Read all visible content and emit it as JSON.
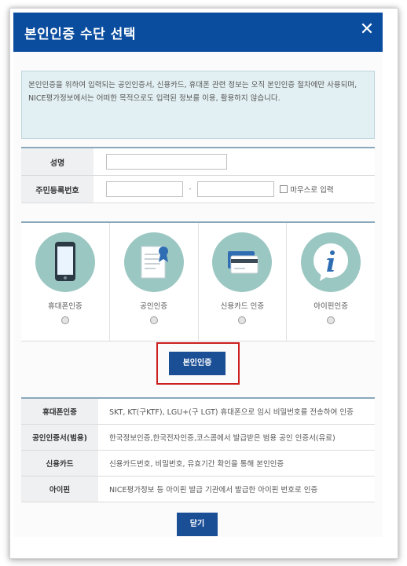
{
  "dialog": {
    "title": "본인인증 수단 선택",
    "close_icon": "close-icon",
    "notice": "본인인증을 위하여 입력되는 공인인증서, 신용카드, 휴대폰 관련 정보는 오직 본인인증 절차에만 사용되며, NICE평가정보에서는 어떠한 목적으로도 입력된 정보를 이용, 활용하지 않습니다."
  },
  "form": {
    "name_label": "성명",
    "name_value": "",
    "rrn_label": "주민등록번호",
    "rrn_first": "",
    "rrn_dash": "-",
    "rrn_second": "",
    "mouse_input_label": "마우스로 입력"
  },
  "methods": [
    {
      "label": "휴대폰인증",
      "icon": "smartphone-icon"
    },
    {
      "label": "공인인증",
      "icon": "certificate-icon"
    },
    {
      "label": "신용카드 인증",
      "icon": "credit-card-icon"
    },
    {
      "label": "아이핀인증",
      "icon": "info-icon"
    }
  ],
  "verify_button": "본인인증",
  "info_rows": [
    {
      "label": "휴대폰인증",
      "desc": "SKT, KT(구KTF), LGU+(구 LGT) 휴대폰으로 임시 비밀번호를 전송하여 인증"
    },
    {
      "label": "공인인증서(범용)",
      "desc": "한국정보인증,한국전자인증,코스콤에서 발급받은 범용 공인 인증서(유료)"
    },
    {
      "label": "신용카드",
      "desc": "신용카드번호, 비밀번호, 유효기간 확인을 통해 본인인증"
    },
    {
      "label": "아이핀",
      "desc": "NICE평가정보 등 아이핀 발급 기관에서 발급한 아이핀 번호로 인증"
    }
  ],
  "close_button": "닫기",
  "colors": {
    "title_bar": "#0a4d9f",
    "button": "#1a4f96",
    "icon_circle": "#9bc7c2",
    "highlight": "#cc1f1f",
    "notice_bg": "#e3f0f3"
  }
}
